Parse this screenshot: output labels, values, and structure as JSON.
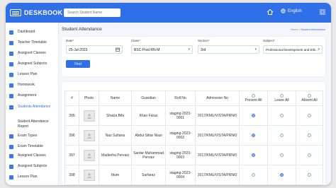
{
  "header": {
    "brand": "DESKBOOK",
    "search_placeholder": "Search Student Name",
    "language": "English"
  },
  "sidebar": {
    "items": [
      {
        "label": "Dashboard",
        "active": false
      },
      {
        "label": "Teacher Timetable",
        "active": false
      },
      {
        "label": "Assigned Classes",
        "active": false
      },
      {
        "label": "Assigned Subjects",
        "active": false
      },
      {
        "label": "Lesson Plan",
        "active": false
      },
      {
        "label": "Homework",
        "active": false
      },
      {
        "label": "Assignment",
        "active": false
      },
      {
        "label": "Students Attendance",
        "active": true
      },
      {
        "label": "Student Attendance Report",
        "active": false
      },
      {
        "label": "Exam Types",
        "active": false
      },
      {
        "label": "Exam Timetable",
        "active": false
      },
      {
        "label": "Assigned Classes",
        "active": false
      },
      {
        "label": "Assigned Subjects",
        "active": false
      },
      {
        "label": "Lesson Plan",
        "active": false
      }
    ]
  },
  "page": {
    "title": "Student Attendance",
    "breadcrumb": {
      "home": "Home",
      "separator": "/",
      "current": "Student Attendance"
    }
  },
  "filters": {
    "date": {
      "label": "Date",
      "value": "25-Jul-2023"
    },
    "class": {
      "label": "Class",
      "value": "BSC-Post RN-M"
    },
    "section": {
      "label": "Section",
      "value": "3rd"
    },
    "subject": {
      "label": "Subject",
      "value": "Professional Development and Ethi..."
    },
    "find_label": "Find"
  },
  "table": {
    "headers": {
      "num": "#",
      "photo": "Photo",
      "name": "Name",
      "guardian": "Guardian",
      "roll": "Roll No",
      "admission": "Admission No",
      "present": "Present All",
      "leave": "Leave All",
      "absent": "Absent All"
    },
    "rows": [
      {
        "num": "395",
        "name": "Shaiza Bibi",
        "guardian": "Khan Faraz",
        "roll": "staging-2023-0001",
        "admission": "2017/KMU/VISTA/PRN/0",
        "status": "present"
      },
      {
        "num": "396",
        "name": "Naz Sultana",
        "guardian": "Abdul Sittar Niazi",
        "roll": "staging-2023-0002",
        "admission": "2017/KMU/VISTA/PRN/0",
        "status": "present"
      },
      {
        "num": "397",
        "name": "Madeeha Pervaiz",
        "guardian": "Sardar Muhammad Pervaiz",
        "roll": "staging-2023-0003",
        "admission": "2017/KMU/VISTA/PRN/0",
        "status": "present"
      },
      {
        "num": "398",
        "name": "Ittum",
        "guardian": "Sarfaraz",
        "roll": "staging-2023-0004",
        "admission": "2017/KMU/VISTA/PRN/0",
        "status": "leave"
      }
    ]
  },
  "colors": {
    "accent": "#2f6fe8",
    "sidebar_icon": "#3a79ef"
  }
}
